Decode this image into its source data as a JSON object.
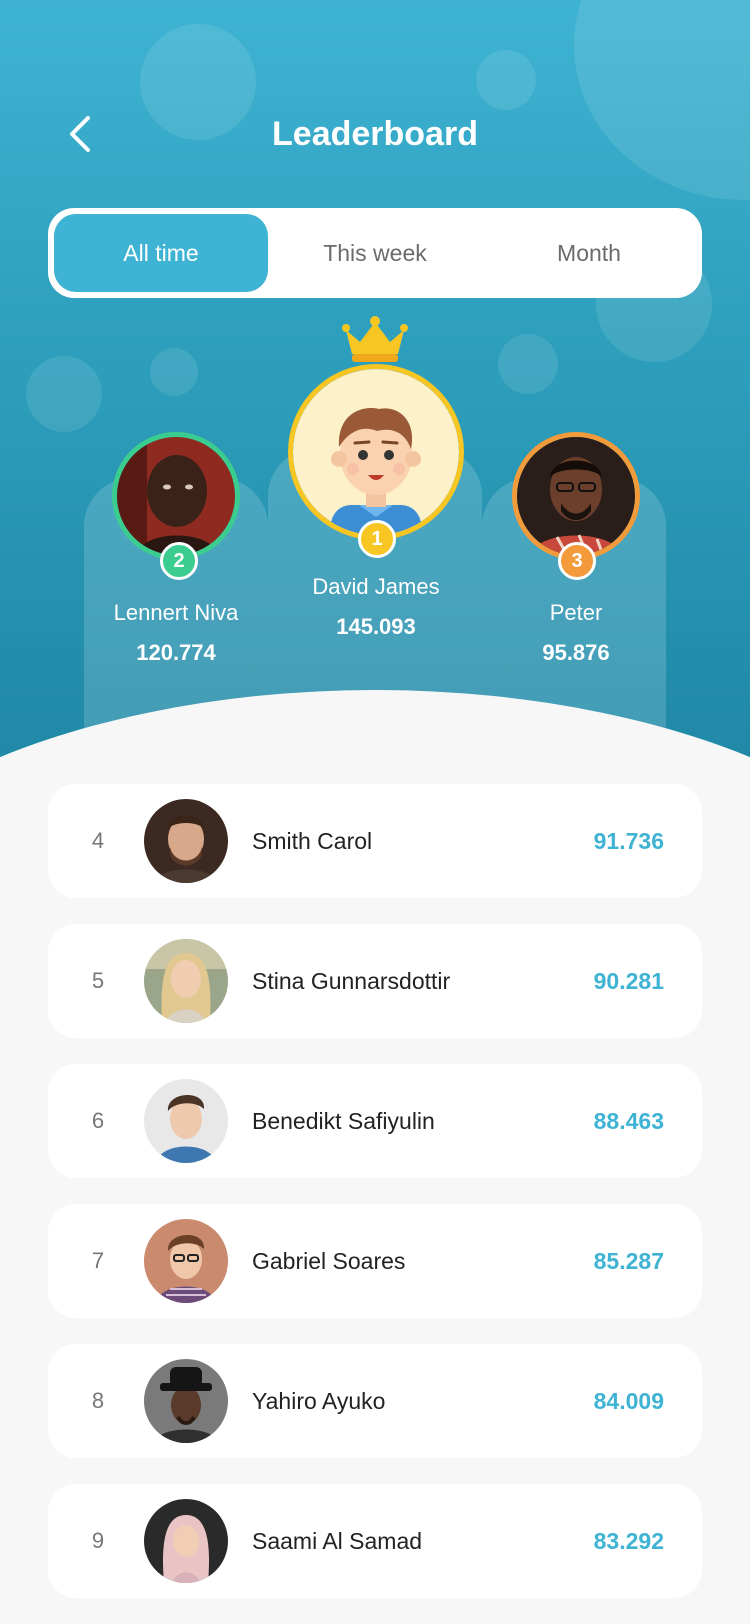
{
  "header": {
    "title": "Leaderboard",
    "back_icon": "chevron-left-icon"
  },
  "tabs": [
    {
      "label": "All time",
      "active": true
    },
    {
      "label": "This week",
      "active": false
    },
    {
      "label": "Month",
      "active": false
    }
  ],
  "colors": {
    "accent": "#3fb3d3",
    "gold": "#f7c623",
    "silver_rank": "#3bcc8f",
    "bronze_rank": "#f39a3b"
  },
  "top_three": [
    {
      "rank": "1",
      "name": "David James",
      "score": "145.093",
      "crown_icon": "crown-icon"
    },
    {
      "rank": "2",
      "name": "Lennert Niva",
      "score": "120.774"
    },
    {
      "rank": "3",
      "name": "Peter",
      "score": "95.876"
    }
  ],
  "leaderboard": [
    {
      "rank": "4",
      "name": "Smith Carol",
      "score": "91.736"
    },
    {
      "rank": "5",
      "name": "Stina Gunnarsdottir",
      "score": "90.281"
    },
    {
      "rank": "6",
      "name": "Benedikt Safiyulin",
      "score": "88.463"
    },
    {
      "rank": "7",
      "name": "Gabriel Soares",
      "score": "85.287"
    },
    {
      "rank": "8",
      "name": "Yahiro Ayuko",
      "score": "84.009"
    },
    {
      "rank": "9",
      "name": "Saami Al Samad",
      "score": "83.292"
    }
  ]
}
